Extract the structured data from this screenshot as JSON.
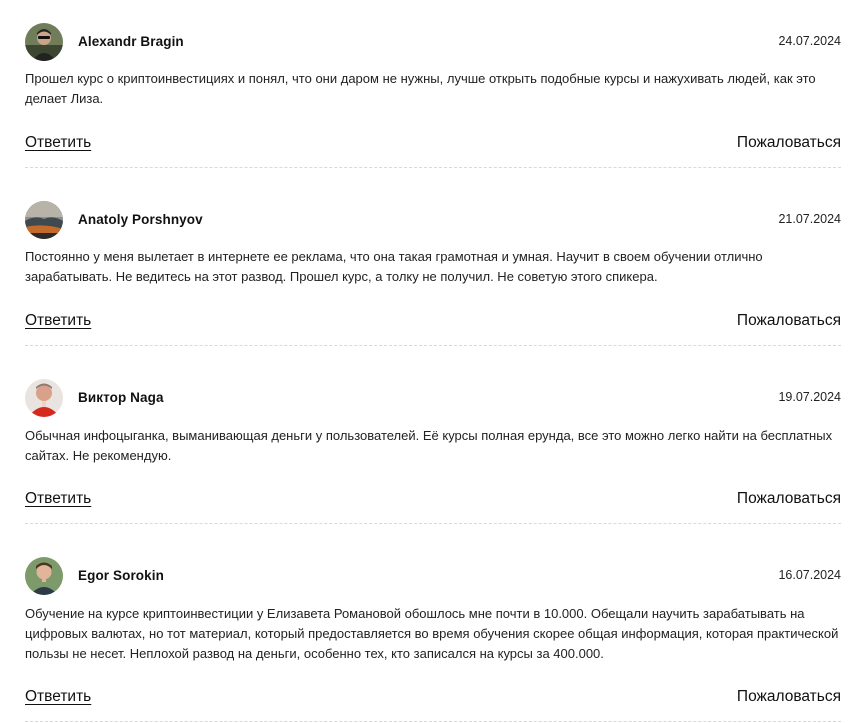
{
  "comments": [
    {
      "author": "Alexandr Bragin",
      "date": "24.07.2024",
      "text": "Прошел курс о криптоинвестициях и понял, что они даром не нужны, лучше открыть подобные курсы и нажухивать людей, как это делает Лиза.",
      "reply_label": "Ответить",
      "report_label": "Пожаловаться"
    },
    {
      "author": "Anatoly Porshnyov",
      "date": "21.07.2024",
      "text": "Постоянно у меня вылетает в интернете ее реклама, что она такая грамотная и умная. Научит в своем обучении отлично зарабатывать. Не ведитесь на этот развод. Прошел курс, а толку не получил. Не советую этого спикера.",
      "reply_label": "Ответить",
      "report_label": "Пожаловаться"
    },
    {
      "author": "Виктор Naga",
      "date": "19.07.2024",
      "text": "Обычная инфоцыганка, выманивающая деньги у пользователей. Её курсы полная ерунда, все это можно легко найти на бесплатных сайтах. Не рекомендую.",
      "reply_label": "Ответить",
      "report_label": "Пожаловаться"
    },
    {
      "author": "Egor Sorokin",
      "date": "16.07.2024",
      "text": "Обучение на курсе криптоинвестиции у Елизавета Романовой обошлось мне почти в 10.000. Обещали научить зарабатывать на цифровых валютах, но тот материал, который предоставляется во время обучения скорее общая информация, которая практической пользы не несет. Неплохой развод на деньги, особенно тех, кто записался на курсы за 400.000.",
      "reply_label": "Ответить",
      "report_label": "Пожаловаться"
    }
  ]
}
